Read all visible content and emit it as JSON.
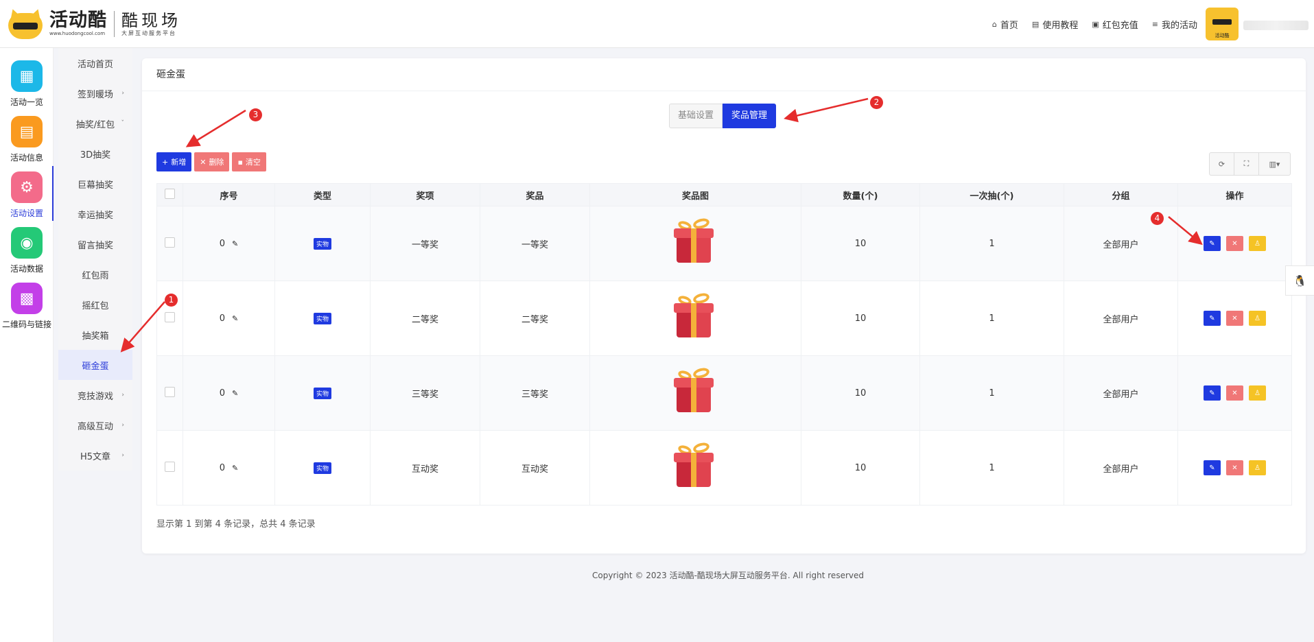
{
  "brand": {
    "name": "活动酷",
    "url": "www.huodongcool.com",
    "sub_name": "酷现场",
    "sub_tagline": "大屏互动服务平台",
    "avatar_text": "活动酷"
  },
  "topnav": [
    {
      "icon": "home-icon",
      "glyph": "⌂",
      "label": "首页"
    },
    {
      "icon": "document-icon",
      "glyph": "▤",
      "label": "使用教程"
    },
    {
      "icon": "wallet-icon",
      "glyph": "▣",
      "label": "红包充值"
    },
    {
      "icon": "list-icon",
      "glyph": "≡",
      "label": "我的活动"
    }
  ],
  "iconbar": [
    {
      "label": "活动一览",
      "color": "#1cb8e8",
      "icon": "grid-icon",
      "glyph": "▦"
    },
    {
      "label": "活动信息",
      "color": "#fa9a1f",
      "icon": "file-icon",
      "glyph": "▤"
    },
    {
      "label": "活动设置",
      "color": "#f36b8a",
      "icon": "gear-icon",
      "glyph": "⚙",
      "active": true
    },
    {
      "label": "活动数据",
      "color": "#24c977",
      "icon": "database-icon",
      "glyph": "◉"
    },
    {
      "label": "二维码与链接",
      "color": "#c33fe8",
      "icon": "qrcode-icon",
      "glyph": "▩"
    }
  ],
  "submenu": [
    {
      "label": "活动首页",
      "arrow": ""
    },
    {
      "label": "签到暖场",
      "arrow": "›"
    },
    {
      "label": "抽奖/红包",
      "arrow": "ˇ"
    },
    {
      "label": "3D抽奖",
      "arrow": ""
    },
    {
      "label": "巨幕抽奖",
      "arrow": ""
    },
    {
      "label": "幸运抽奖",
      "arrow": ""
    },
    {
      "label": "留言抽奖",
      "arrow": ""
    },
    {
      "label": "红包雨",
      "arrow": ""
    },
    {
      "label": "摇红包",
      "arrow": ""
    },
    {
      "label": "抽奖箱",
      "arrow": ""
    },
    {
      "label": "砸金蛋",
      "arrow": "",
      "active": true
    },
    {
      "label": "竞技游戏",
      "arrow": "›"
    },
    {
      "label": "高级互动",
      "arrow": "›"
    },
    {
      "label": "H5文章",
      "arrow": "›"
    }
  ],
  "card": {
    "title": "砸金蛋",
    "tabs": [
      "基础设置",
      "奖品管理"
    ],
    "buttons": {
      "add": "新增",
      "delete": "删除",
      "clear": "清空"
    },
    "tool_icons": [
      "refresh-icon",
      "fullscreen-icon",
      "columns-icon"
    ],
    "columns": [
      "序号",
      "类型",
      "奖项",
      "奖品",
      "奖品图",
      "数量(个)",
      "一次抽(个)",
      "分组",
      "操作"
    ],
    "rows": [
      {
        "index": "0",
        "type": "实物",
        "award": "一等奖",
        "prize": "一等奖",
        "qty": "10",
        "once": "1",
        "group": "全部用户"
      },
      {
        "index": "0",
        "type": "实物",
        "award": "二等奖",
        "prize": "二等奖",
        "qty": "10",
        "once": "1",
        "group": "全部用户"
      },
      {
        "index": "0",
        "type": "实物",
        "award": "三等奖",
        "prize": "三等奖",
        "qty": "10",
        "once": "1",
        "group": "全部用户"
      },
      {
        "index": "0",
        "type": "实物",
        "award": "互动奖",
        "prize": "互动奖",
        "qty": "10",
        "once": "1",
        "group": "全部用户"
      }
    ],
    "footer": "显示第 1 到第 4 条记录，总共 4 条记录"
  },
  "copyright": "Copyright © 2023 活动酷-酷现场大屏互动服务平台. All right reserved",
  "annotations": [
    "1",
    "2",
    "3",
    "4"
  ],
  "colors": {
    "primary": "#1f3ae0",
    "danger": "#f07777",
    "warning": "#f5c325",
    "annotation": "#e52d2d"
  }
}
